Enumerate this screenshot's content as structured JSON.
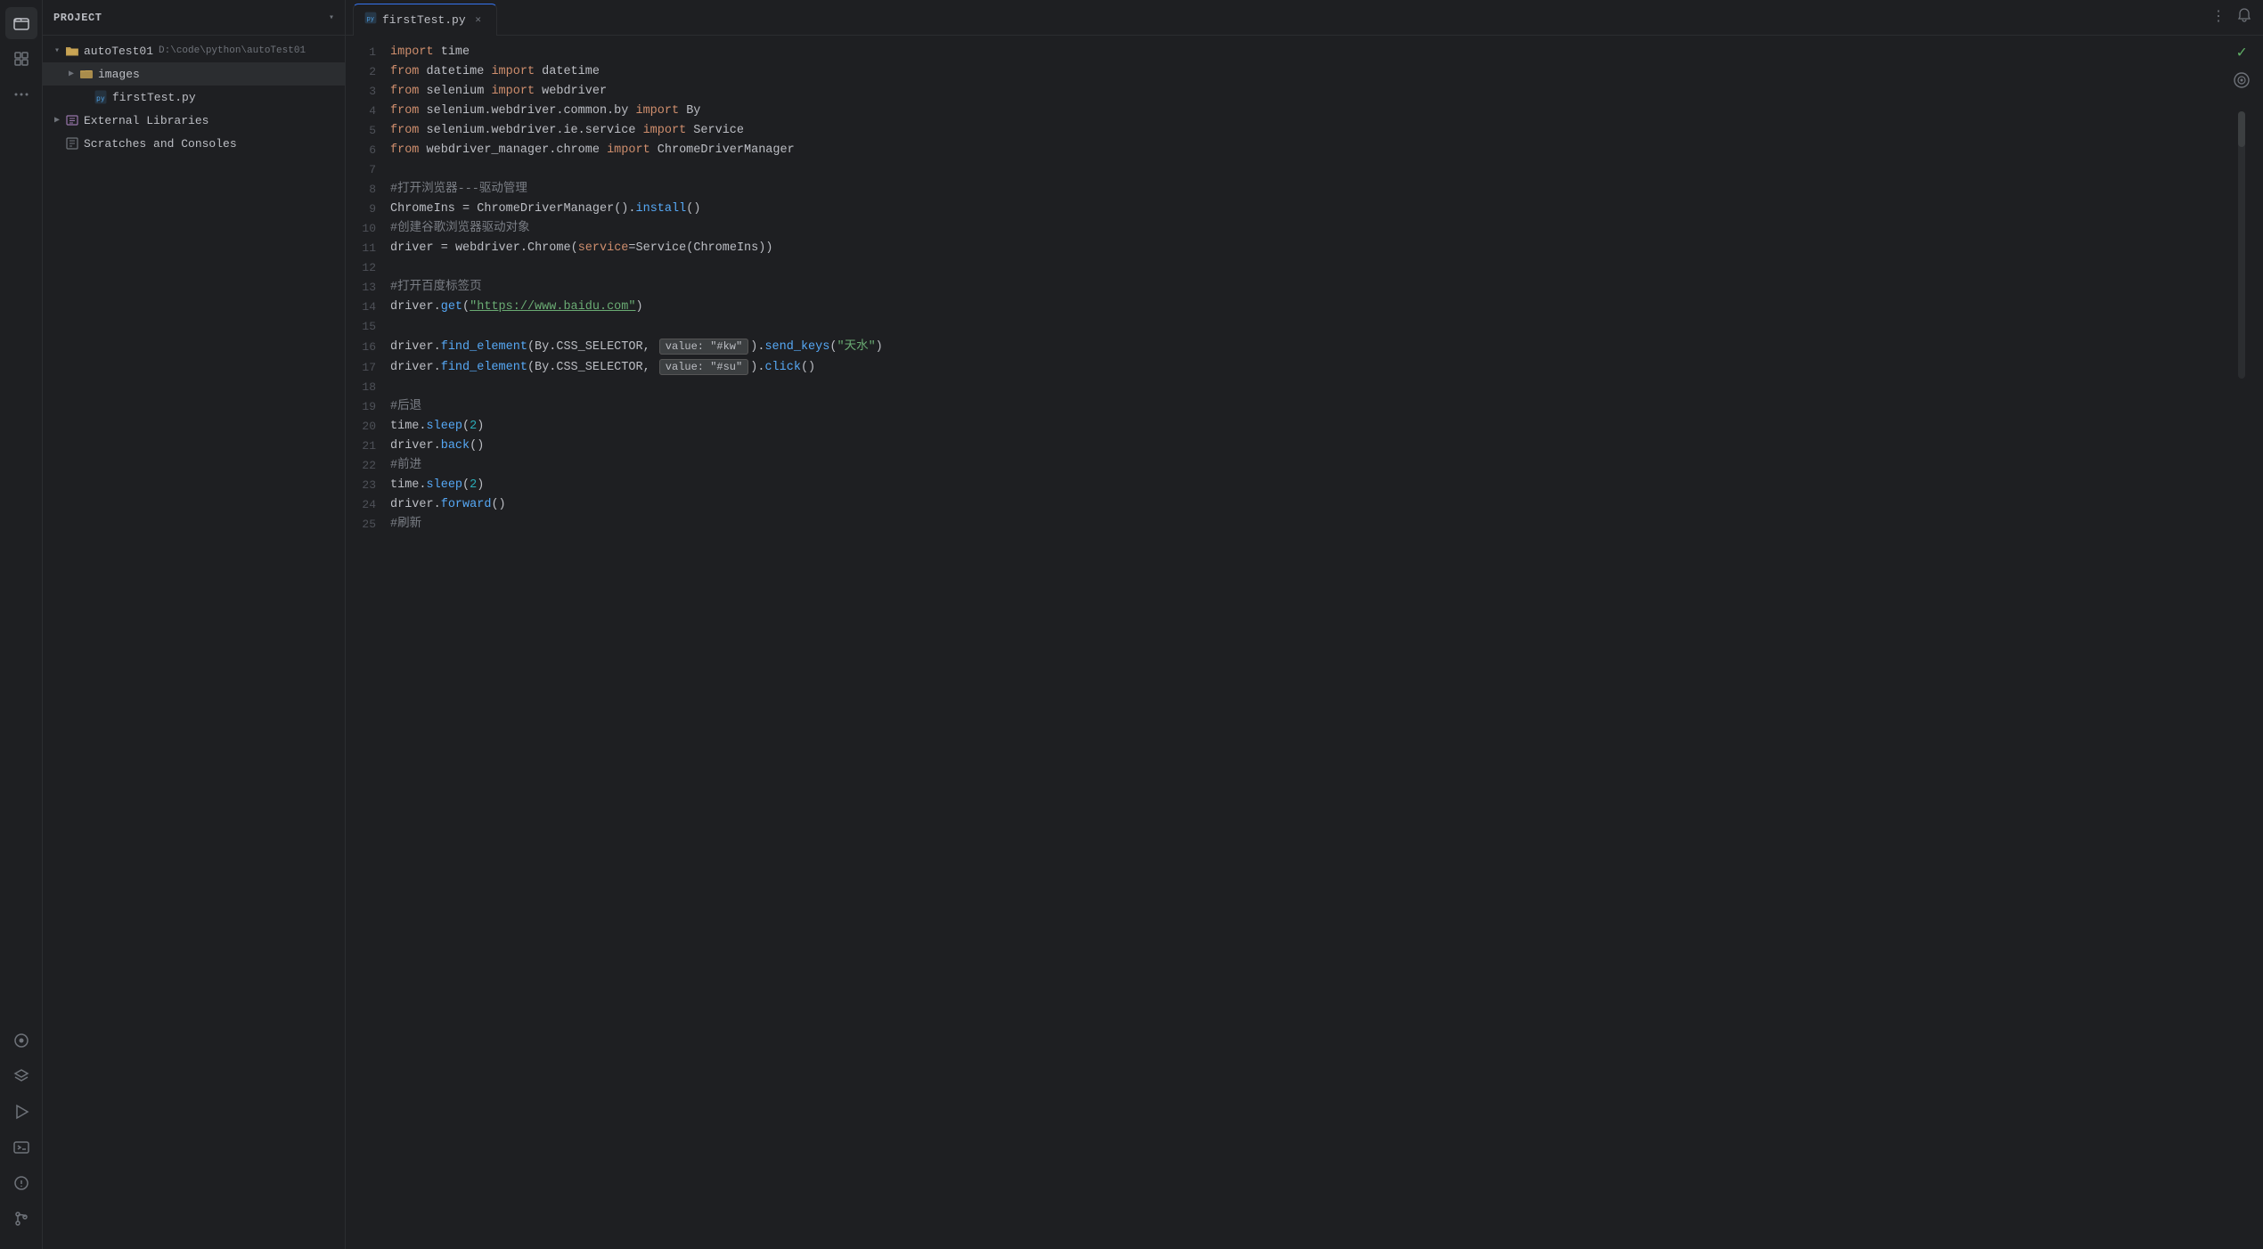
{
  "sidebar": {
    "header_title": "Project",
    "header_chevron": "▾",
    "tree": [
      {
        "id": "autoTest01",
        "label": "autoTest01",
        "secondary": "D:\\code\\python\\autoTest01",
        "type": "folder",
        "indent": 1,
        "arrow": "▶",
        "expanded": true
      },
      {
        "id": "images",
        "label": "images",
        "type": "folder",
        "indent": 2,
        "arrow": "▶",
        "expanded": false
      },
      {
        "id": "firstTest.py",
        "label": "firstTest.py",
        "type": "python",
        "indent": 3,
        "arrow": ""
      },
      {
        "id": "external-libraries",
        "label": "External Libraries",
        "type": "library",
        "indent": 1,
        "arrow": "▶",
        "expanded": false
      },
      {
        "id": "scratches",
        "label": "Scratches and Consoles",
        "type": "scratch",
        "indent": 1,
        "arrow": ""
      }
    ]
  },
  "tabs": [
    {
      "name": "firstTest.py",
      "icon": "🐍",
      "active": true,
      "closable": true
    }
  ],
  "editor": {
    "filename": "firstTest.py",
    "lines": [
      {
        "num": 1,
        "tokens": [
          {
            "t": "kw",
            "v": "import"
          },
          {
            "t": "sp",
            "v": " "
          },
          {
            "t": "module",
            "v": "time"
          }
        ]
      },
      {
        "num": 2,
        "tokens": [
          {
            "t": "kw2",
            "v": "from"
          },
          {
            "t": "sp",
            "v": " "
          },
          {
            "t": "module",
            "v": "datetime"
          },
          {
            "t": "sp",
            "v": " "
          },
          {
            "t": "kw2",
            "v": "import"
          },
          {
            "t": "sp",
            "v": " "
          },
          {
            "t": "module",
            "v": "datetime"
          }
        ]
      },
      {
        "num": 3,
        "tokens": [
          {
            "t": "kw2",
            "v": "from"
          },
          {
            "t": "sp",
            "v": " "
          },
          {
            "t": "module",
            "v": "selenium"
          },
          {
            "t": "sp",
            "v": " "
          },
          {
            "t": "kw2",
            "v": "import"
          },
          {
            "t": "sp",
            "v": " "
          },
          {
            "t": "module",
            "v": "webdriver"
          }
        ]
      },
      {
        "num": 4,
        "tokens": [
          {
            "t": "kw2",
            "v": "from"
          },
          {
            "t": "sp",
            "v": " "
          },
          {
            "t": "module",
            "v": "selenium.webdriver.common.by"
          },
          {
            "t": "sp",
            "v": " "
          },
          {
            "t": "kw2",
            "v": "import"
          },
          {
            "t": "sp",
            "v": " "
          },
          {
            "t": "module",
            "v": "By"
          }
        ]
      },
      {
        "num": 5,
        "tokens": [
          {
            "t": "kw2",
            "v": "from"
          },
          {
            "t": "sp",
            "v": " "
          },
          {
            "t": "module",
            "v": "selenium.webdriver.ie.service"
          },
          {
            "t": "sp",
            "v": " "
          },
          {
            "t": "kw2",
            "v": "import"
          },
          {
            "t": "sp",
            "v": " "
          },
          {
            "t": "module",
            "v": "Service"
          }
        ]
      },
      {
        "num": 6,
        "tokens": [
          {
            "t": "kw2",
            "v": "from"
          },
          {
            "t": "sp",
            "v": " "
          },
          {
            "t": "module",
            "v": "webdriver_manager.chrome"
          },
          {
            "t": "sp",
            "v": " "
          },
          {
            "t": "kw2",
            "v": "import"
          },
          {
            "t": "sp",
            "v": " "
          },
          {
            "t": "module",
            "v": "ChromeDriverManager"
          }
        ]
      },
      {
        "num": 7,
        "tokens": []
      },
      {
        "num": 8,
        "tokens": [
          {
            "t": "comment",
            "v": "#打开浏览器---驱动管理"
          }
        ]
      },
      {
        "num": 9,
        "tokens": [
          {
            "t": "module",
            "v": "ChromeIns"
          },
          {
            "t": "sp",
            "v": " "
          },
          {
            "t": "op",
            "v": "="
          },
          {
            "t": "sp",
            "v": " "
          },
          {
            "t": "module",
            "v": "ChromeDriverManager"
          },
          {
            "t": "paren",
            "v": "()"
          },
          {
            "t": "op",
            "v": "."
          },
          {
            "t": "func",
            "v": "install"
          },
          {
            "t": "paren",
            "v": "()"
          }
        ]
      },
      {
        "num": 10,
        "tokens": [
          {
            "t": "comment",
            "v": "#创建谷歌浏览器驱动对象"
          }
        ]
      },
      {
        "num": 11,
        "tokens": [
          {
            "t": "module",
            "v": "driver"
          },
          {
            "t": "sp",
            "v": " "
          },
          {
            "t": "op",
            "v": "="
          },
          {
            "t": "sp",
            "v": " "
          },
          {
            "t": "module",
            "v": "webdriver"
          },
          {
            "t": "op",
            "v": "."
          },
          {
            "t": "module",
            "v": "Chrome"
          },
          {
            "t": "paren",
            "v": "("
          },
          {
            "t": "param",
            "v": "service"
          },
          {
            "t": "op",
            "v": "="
          },
          {
            "t": "module",
            "v": "Service"
          },
          {
            "t": "paren",
            "v": "("
          },
          {
            "t": "module",
            "v": "ChromeIns"
          },
          {
            "t": "paren",
            "v": "))"
          }
        ]
      },
      {
        "num": 12,
        "tokens": []
      },
      {
        "num": 13,
        "tokens": [
          {
            "t": "comment",
            "v": "#打开百度标签页"
          }
        ]
      },
      {
        "num": 14,
        "tokens": [
          {
            "t": "module",
            "v": "driver"
          },
          {
            "t": "op",
            "v": "."
          },
          {
            "t": "func",
            "v": "get"
          },
          {
            "t": "paren",
            "v": "("
          },
          {
            "t": "string-link",
            "v": "\"https://www.baidu.com\""
          },
          {
            "t": "paren",
            "v": ")"
          }
        ]
      },
      {
        "num": 15,
        "tokens": []
      },
      {
        "num": 16,
        "tokens": [
          {
            "t": "module",
            "v": "driver"
          },
          {
            "t": "op",
            "v": "."
          },
          {
            "t": "func",
            "v": "find_element"
          },
          {
            "t": "paren",
            "v": "("
          },
          {
            "t": "module",
            "v": "By"
          },
          {
            "t": "op",
            "v": "."
          },
          {
            "t": "module",
            "v": "CSS_SELECTOR"
          },
          {
            "t": "op",
            "v": ","
          },
          {
            "t": "sp",
            "v": " "
          },
          {
            "t": "hint",
            "v": "value: \"#kw\""
          },
          {
            "t": "paren",
            "v": ")"
          },
          {
            "t": "op",
            "v": "."
          },
          {
            "t": "func",
            "v": "send_keys"
          },
          {
            "t": "paren",
            "v": "("
          },
          {
            "t": "string",
            "v": "\"天水\""
          },
          {
            "t": "paren",
            "v": ")"
          }
        ]
      },
      {
        "num": 17,
        "tokens": [
          {
            "t": "module",
            "v": "driver"
          },
          {
            "t": "op",
            "v": "."
          },
          {
            "t": "func",
            "v": "find_element"
          },
          {
            "t": "paren",
            "v": "("
          },
          {
            "t": "module",
            "v": "By"
          },
          {
            "t": "op",
            "v": "."
          },
          {
            "t": "module",
            "v": "CSS_SELECTOR"
          },
          {
            "t": "op",
            "v": ","
          },
          {
            "t": "sp",
            "v": " "
          },
          {
            "t": "hint",
            "v": "value: \"#su\""
          },
          {
            "t": "paren",
            "v": ")"
          },
          {
            "t": "op",
            "v": "."
          },
          {
            "t": "func",
            "v": "click"
          },
          {
            "t": "paren",
            "v": "()"
          }
        ]
      },
      {
        "num": 18,
        "tokens": []
      },
      {
        "num": 19,
        "tokens": [
          {
            "t": "comment",
            "v": "#后退"
          }
        ]
      },
      {
        "num": 20,
        "tokens": [
          {
            "t": "module",
            "v": "time"
          },
          {
            "t": "op",
            "v": "."
          },
          {
            "t": "func",
            "v": "sleep"
          },
          {
            "t": "paren",
            "v": "("
          },
          {
            "t": "number",
            "v": "2"
          },
          {
            "t": "paren",
            "v": ")"
          }
        ]
      },
      {
        "num": 21,
        "tokens": [
          {
            "t": "module",
            "v": "driver"
          },
          {
            "t": "op",
            "v": "."
          },
          {
            "t": "func",
            "v": "back"
          },
          {
            "t": "paren",
            "v": "()"
          }
        ]
      },
      {
        "num": 22,
        "tokens": [
          {
            "t": "comment",
            "v": "#前进"
          }
        ]
      },
      {
        "num": 23,
        "tokens": [
          {
            "t": "module",
            "v": "time"
          },
          {
            "t": "op",
            "v": "."
          },
          {
            "t": "func",
            "v": "sleep"
          },
          {
            "t": "paren",
            "v": "("
          },
          {
            "t": "number",
            "v": "2"
          },
          {
            "t": "paren",
            "v": ")"
          }
        ]
      },
      {
        "num": 24,
        "tokens": [
          {
            "t": "module",
            "v": "driver"
          },
          {
            "t": "op",
            "v": "."
          },
          {
            "t": "func",
            "v": "forward"
          },
          {
            "t": "paren",
            "v": "()"
          }
        ]
      },
      {
        "num": 25,
        "tokens": [
          {
            "t": "comment",
            "v": "#刷新"
          }
        ]
      }
    ]
  },
  "activity_bar": {
    "icons": [
      {
        "name": "folder-icon",
        "glyph": "📁",
        "active": true
      },
      {
        "name": "structure-icon",
        "glyph": "⊞"
      },
      {
        "name": "more-icon",
        "glyph": "⋯"
      }
    ],
    "bottom_icons": [
      {
        "name": "plugin-icon",
        "glyph": "🔌"
      },
      {
        "name": "layers-icon",
        "glyph": "◫"
      },
      {
        "name": "run-icon",
        "glyph": "▷"
      },
      {
        "name": "terminal-icon",
        "glyph": "⬛"
      },
      {
        "name": "problems-icon",
        "glyph": "⚠"
      },
      {
        "name": "git-icon",
        "glyph": "⑂"
      }
    ]
  },
  "status": {
    "check": "✓",
    "ai": "◎"
  },
  "more_button_label": "⋮",
  "bell_label": "🔔"
}
